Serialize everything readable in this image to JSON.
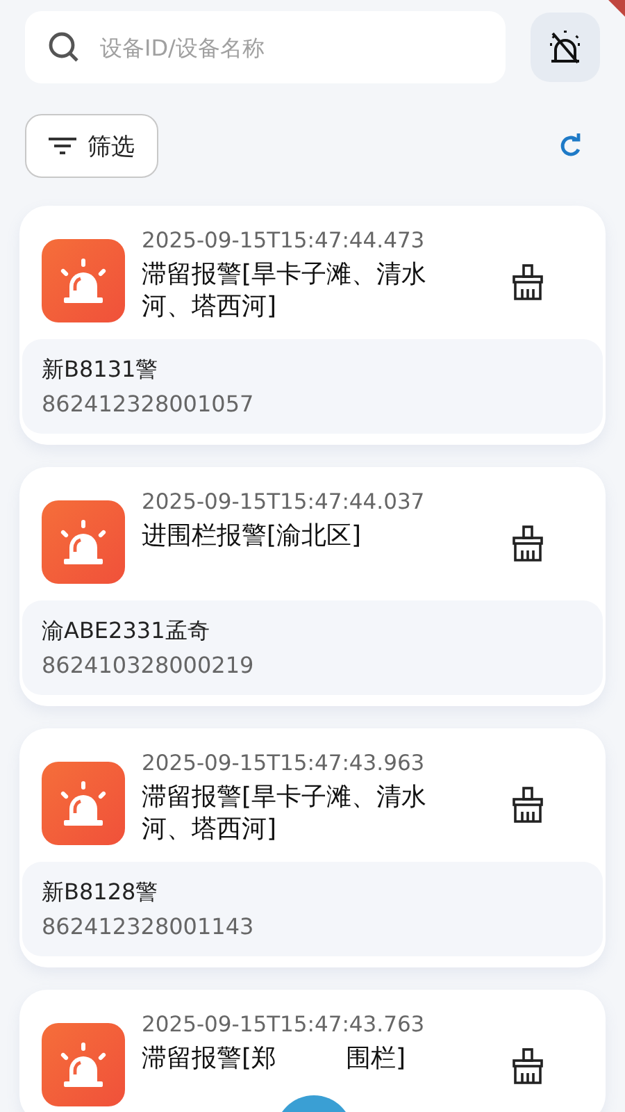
{
  "search": {
    "placeholder": "设备ID/设备名称"
  },
  "filter_button": {
    "label": "筛选"
  },
  "alarms": [
    {
      "time": "2025-09-15T15:47:44.473",
      "title": "滞留报警[旱卡子滩、清水河、塔西河]",
      "vehicle": "新B8131警",
      "device_id": "862412328001057"
    },
    {
      "time": "2025-09-15T15:47:44.037",
      "title": "进围栏报警[渝北区]",
      "vehicle": "渝ABE2331孟奇",
      "device_id": "862410328000219"
    },
    {
      "time": "2025-09-15T15:47:43.963",
      "title": "滞留报警[旱卡子滩、清水河、塔西河]",
      "vehicle": "新B8128警",
      "device_id": "862412328001143"
    },
    {
      "time": "2025-09-15T15:47:43.763",
      "title": "滞留报警[郑",
      "title_after": "围栏]"
    }
  ]
}
